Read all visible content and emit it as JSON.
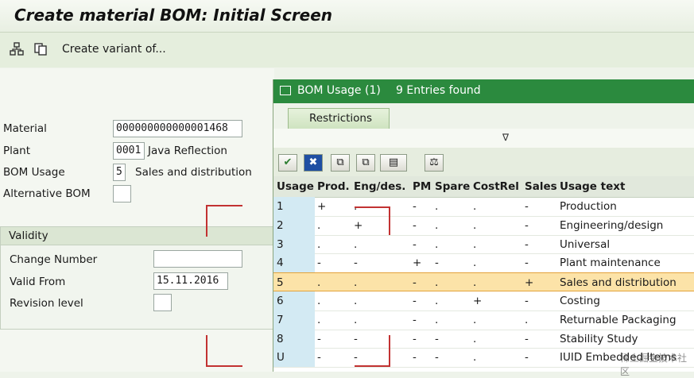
{
  "window": {
    "title": "Create material BOM: Initial Screen"
  },
  "toolbar": {
    "variant_label": "Create variant of..."
  },
  "form": {
    "material_label": "Material",
    "material_value": "000000000000001468",
    "plant_label": "Plant",
    "plant_value": "0001",
    "plant_desc": "Java Reflection",
    "bom_usage_label": "BOM Usage",
    "bom_usage_value": "5",
    "bom_usage_desc": "Sales and distribution",
    "alt_bom_label": "Alternative BOM",
    "alt_bom_value": ""
  },
  "validity": {
    "title": "Validity",
    "change_number_label": "Change Number",
    "change_number_value": "",
    "valid_from_label": "Valid From",
    "valid_from_value": "15.11.2016",
    "revision_label": "Revision level",
    "revision_value": ""
  },
  "popup": {
    "title": "BOM Usage (1)",
    "count": "9 Entries found",
    "tab_label": "Restrictions",
    "strip_mark": "∇",
    "buttons": {
      "ok": "✔",
      "cancel": "✖",
      "find": "⧉",
      "find_next": "⧉",
      "print": "▤",
      "sort": "⚖"
    },
    "columns": [
      "Usage",
      "Prod.",
      "Eng/des.",
      "PM",
      "Spare",
      "CostRel",
      "Sales",
      "Usage text"
    ],
    "rows": [
      {
        "c": [
          "1",
          "+",
          ".",
          "-",
          ".",
          ".",
          "-",
          "Production"
        ]
      },
      {
        "c": [
          "2",
          ".",
          "+",
          "-",
          ".",
          ".",
          "-",
          "Engineering/design"
        ]
      },
      {
        "c": [
          "3",
          ".",
          ".",
          "-",
          ".",
          ".",
          "-",
          "Universal"
        ]
      },
      {
        "c": [
          "4",
          "-",
          "-",
          "+",
          "-",
          ".",
          "-",
          "Plant maintenance"
        ]
      },
      {
        "c": [
          "5",
          ".",
          ".",
          "-",
          ".",
          ".",
          "+",
          "Sales and distribution"
        ]
      },
      {
        "c": [
          "6",
          ".",
          ".",
          "-",
          ".",
          "+",
          "-",
          "Costing"
        ]
      },
      {
        "c": [
          "7",
          ".",
          ".",
          "-",
          ".",
          ".",
          ".",
          "Returnable Packaging"
        ]
      },
      {
        "c": [
          "8",
          "-",
          "-",
          "-",
          "-",
          ".",
          "-",
          "Stability Study"
        ]
      },
      {
        "c": [
          "U",
          "-",
          "-",
          "-",
          "-",
          ".",
          "-",
          "IUID Embedded Items"
        ]
      }
    ],
    "selected_row": 4
  },
  "watermark": "稀土掘金技术社区",
  "colors": {
    "header_green": "#2b8a3e",
    "selected_row": "#fce3a8",
    "usage_col": "#d3eaf3",
    "marker_red": "#c23232"
  }
}
